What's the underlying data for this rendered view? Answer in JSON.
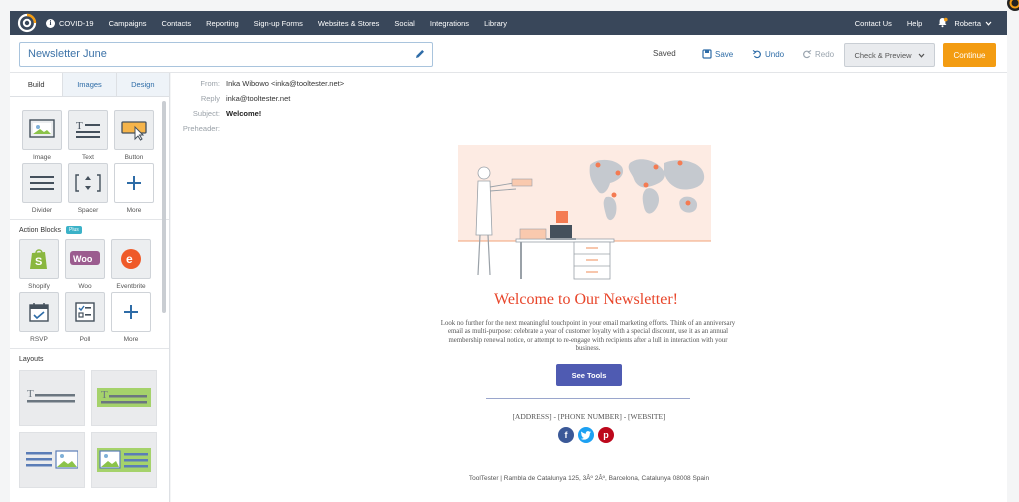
{
  "nav": {
    "items": [
      "COVID-19",
      "Campaigns",
      "Contacts",
      "Reporting",
      "Sign-up Forms",
      "Websites & Stores",
      "Social",
      "Integrations",
      "Library"
    ],
    "right_items": [
      "Contact Us",
      "Help"
    ],
    "user_name": "Roberta"
  },
  "toolbar": {
    "campaign_name": "Newsletter June",
    "status": "Saved",
    "save_label": "Save",
    "undo_label": "Undo",
    "redo_label": "Redo",
    "check_preview_label": "Check & Preview",
    "continue_label": "Continue"
  },
  "sidebar": {
    "tabs": [
      "Build",
      "Images",
      "Design"
    ],
    "active_tab": "Build",
    "build_blocks": [
      "Image",
      "Text",
      "Button",
      "Divider",
      "Spacer",
      "More"
    ],
    "action_blocks_title": "Action Blocks",
    "action_badge": "Plus",
    "action_blocks": [
      "Shopify",
      "Woo",
      "Eventbrite",
      "RSVP",
      "Poll",
      "More"
    ],
    "layouts_title": "Layouts"
  },
  "email": {
    "from_label": "From:",
    "from_value": "Inka Wibowo <inka@tooltester.net>",
    "reply_label": "Reply",
    "reply_value": "inka@tooltester.net",
    "subject_label": "Subject:",
    "subject_value": "Welcome!",
    "preheader_label": "Preheader:",
    "heading": "Welcome to Our Newsletter!",
    "body": "Look no further for the next meaningful touchpoint in your email marketing efforts. Think of an anniversary email as multi-purpose: celebrate a year of customer loyalty with a special discount, use it as an annual membership renewal notice, or attempt to re-engage with recipients after a lull in interaction with your business.",
    "cta": "See Tools",
    "address_line": "[ADDRESS] - [PHONE NUMBER] - [WEBSITE]",
    "footer": "ToolTester | Rambla de Catalunya 125, 3Âº 2Âº, Barcelona, Catalunya 08008 Spain"
  },
  "colors": {
    "nav_bg": "#39475a",
    "accent_blue": "#2e6ca7",
    "continue_orange": "#f39c12",
    "heading_red": "#e8452a",
    "cta_purple": "#4f5bb2"
  }
}
